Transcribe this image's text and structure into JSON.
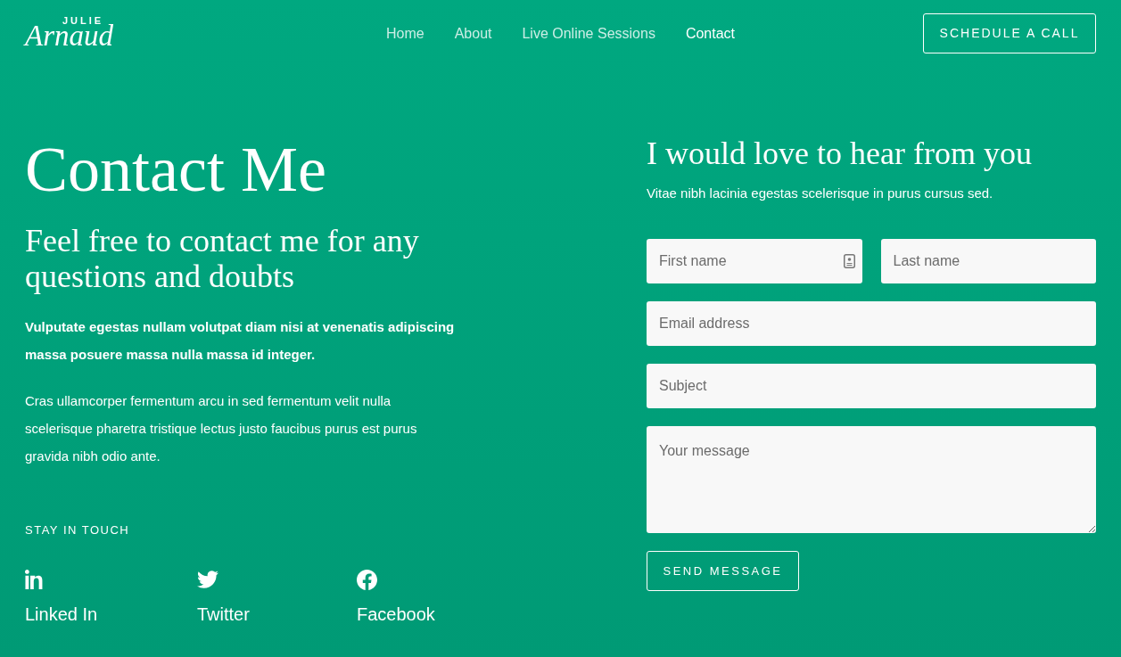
{
  "header": {
    "logo": {
      "small": "JULIE",
      "script": "Arnaud"
    },
    "nav": [
      {
        "label": "Home",
        "selected": false
      },
      {
        "label": "About",
        "selected": false
      },
      {
        "label": "Live Online Sessions",
        "selected": false
      },
      {
        "label": "Contact",
        "selected": true
      }
    ],
    "cta": "SCHEDULE A CALL"
  },
  "intro": {
    "title": "Contact Me",
    "subtitle": "Feel free to contact me for any questions and doubts",
    "lead": "Vulputate egestas nullam volutpat diam nisi at venenatis adipiscing massa posuere massa nulla massa id integer.",
    "body": "Cras ullamcorper fermentum arcu in sed fermentum velit nulla scelerisque pharetra tristique lectus justo faucibus purus est purus gravida nibh odio ante."
  },
  "social": {
    "heading": "STAY IN TOUCH",
    "links": [
      {
        "kind": "linkedin",
        "label": "Linked In"
      },
      {
        "kind": "twitter",
        "label": "Twitter"
      },
      {
        "kind": "facebook",
        "label": "Facebook"
      }
    ]
  },
  "form": {
    "heading": "I would love to hear from you",
    "intro": "Vitae nibh lacinia egestas scelerisque in purus cursus sed.",
    "rows": [
      {
        "fields": [
          {
            "placeholder": "First name",
            "autofill_icon": true
          },
          {
            "placeholder": "Last name",
            "autofill_icon": false
          }
        ]
      },
      {
        "fields": [
          {
            "placeholder": "Email address",
            "autofill_icon": false
          }
        ]
      },
      {
        "fields": [
          {
            "placeholder": "Subject",
            "autofill_icon": false
          }
        ]
      }
    ],
    "message": {
      "placeholder": "Your message"
    },
    "submit": "SEND MESSAGE"
  }
}
